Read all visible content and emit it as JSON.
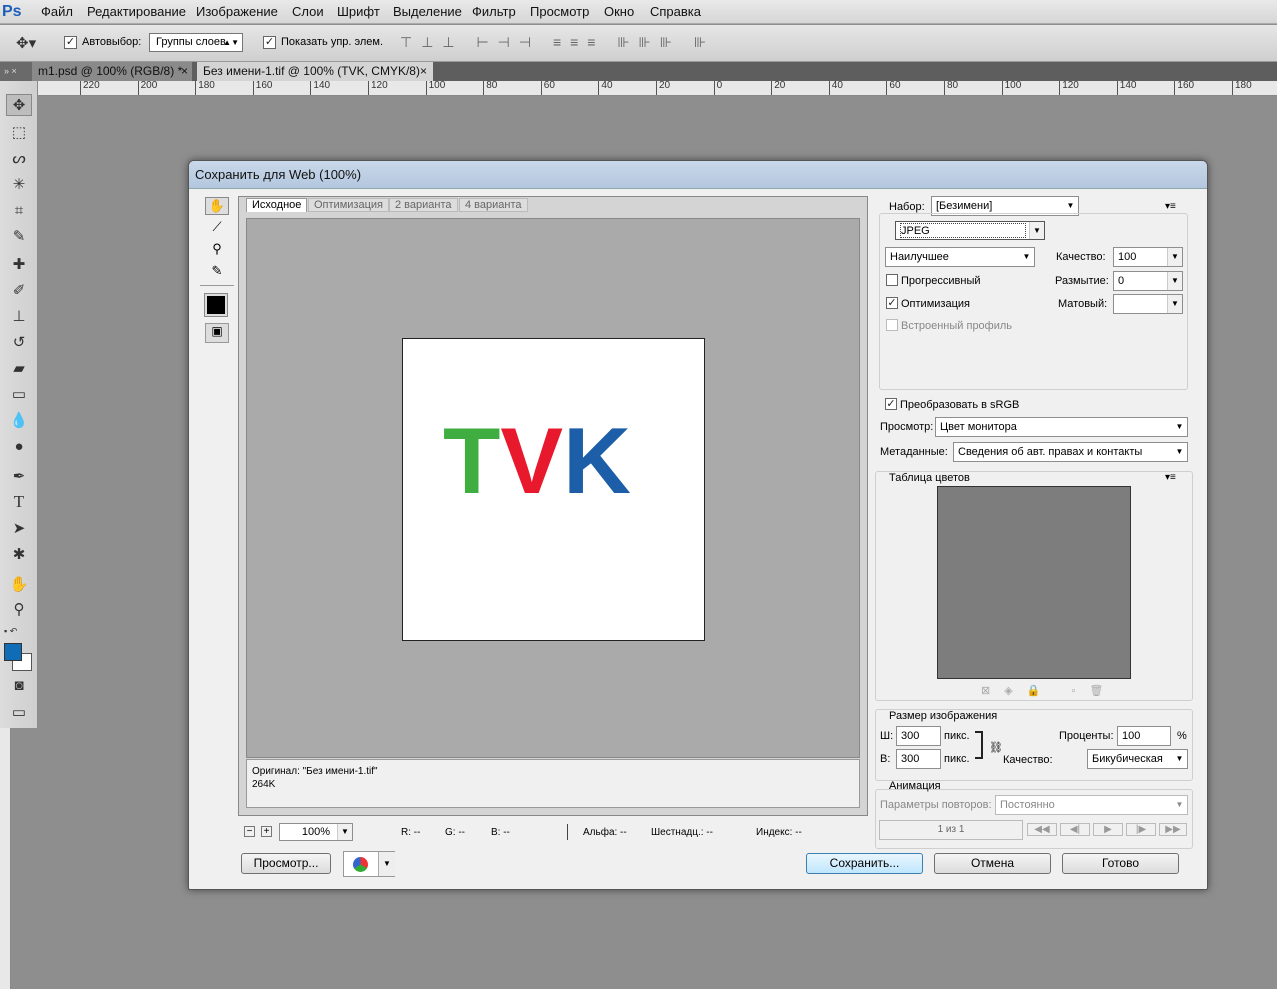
{
  "app": {
    "logo": "Ps"
  },
  "menu": [
    "Файл",
    "Редактирование",
    "Изображение",
    "Слои",
    "Шрифт",
    "Выделение",
    "Фильтр",
    "Просмотр",
    "Окно",
    "Справка"
  ],
  "options": {
    "autoselect_label": "Автовыбор:",
    "autoselect_value": "Группы слоев",
    "show_transform_label": "Показать упр. элем."
  },
  "tabs": [
    {
      "label": "m1.psd @ 100% (RGB/8) *"
    },
    {
      "label": "Без имени-1.tif @ 100% (TVK, CMYK/8)"
    }
  ],
  "ruler": {
    "ticks": [
      "220",
      "200",
      "180",
      "160",
      "140",
      "120",
      "100",
      "80",
      "60",
      "40",
      "20",
      "0",
      "20",
      "40",
      "60",
      "80",
      "100",
      "120",
      "140",
      "160",
      "180"
    ]
  },
  "dialog": {
    "title": "Сохранить для Web (100%)",
    "view_tabs": [
      "Исходное",
      "Оптимизация",
      "2 варианта",
      "4 варианта"
    ],
    "preview_text": {
      "t": "T",
      "v": "V",
      "k": "K"
    },
    "preview_colors": {
      "t": "#3fad3f",
      "v": "#e8192c",
      "k": "#1c5fa8"
    },
    "info_line1": "Оригинал: \"Без имени-1.tif\"",
    "info_line2": "264K",
    "zoom": "100%",
    "status": {
      "r": "R: --",
      "g": "G: --",
      "b": "B: --",
      "alpha": "Альфа: --",
      "hex": "Шестнадц.: --",
      "index": "Индекс: --"
    },
    "preview_button": "Просмотр...",
    "save_button": "Сохранить...",
    "cancel_button": "Отмена",
    "done_button": "Готово",
    "settings": {
      "preset_label": "Набор:",
      "preset_value": "[Безимени]",
      "format_value": "JPEG",
      "quality_preset": "Наилучшее",
      "quality_label": "Качество:",
      "quality_value": "100",
      "blur_label": "Размытие:",
      "blur_value": "0",
      "matte_label": "Матовый:",
      "progressive_label": "Прогрессивный",
      "optimized_label": "Оптимизация",
      "embed_profile_label": "Встроенный профиль",
      "srgb_label": "Преобразовать в sRGB",
      "preview_label": "Просмотр:",
      "preview_value": "Цвет монитора",
      "metadata_label": "Метаданные:",
      "metadata_value": "Сведения об авт. правах и контакты",
      "color_table_label": "Таблица цветов",
      "image_size_label": "Размер изображения",
      "w_label": "Ш:",
      "w_value": "300",
      "h_label": "В:",
      "h_value": "300",
      "px": "пикс.",
      "percent_label": "Проценты:",
      "percent_value": "100",
      "percent_sign": "%",
      "resample_label": "Качество:",
      "resample_value": "Бикубическая",
      "animation_label": "Анимация",
      "loop_label": "Параметры повторов:",
      "loop_value": "Постоянно",
      "frame_counter": "1 из 1"
    }
  }
}
